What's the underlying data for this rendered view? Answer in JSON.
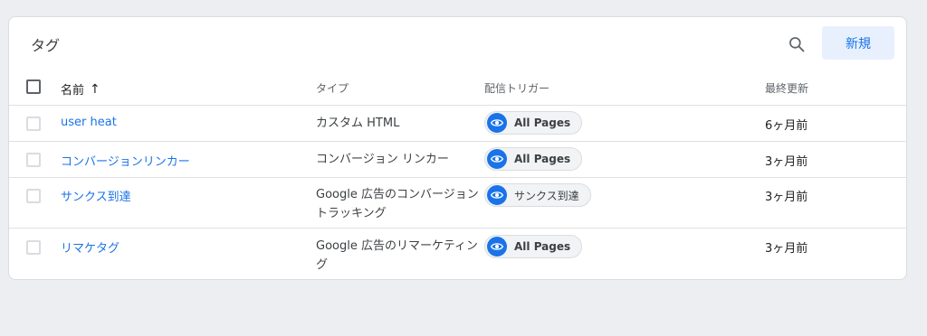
{
  "card": {
    "title": "タグ",
    "new_button": "新規",
    "search_icon": "search-icon"
  },
  "columns": {
    "name": "名前",
    "type": "タイプ",
    "trigger": "配信トリガー",
    "updated": "最終更新",
    "sort_arrow": "↑"
  },
  "colors": {
    "accent": "#1a73e8",
    "chip_bg": "#f1f3f4"
  },
  "rows": [
    {
      "name": "user heat",
      "type": "カスタム HTML",
      "trigger": "All Pages",
      "updated": "6ヶ月前"
    },
    {
      "name": "コンバージョンリンカー",
      "type": "コンバージョン リンカー",
      "trigger": "All Pages",
      "updated": "3ヶ月前"
    },
    {
      "name": "サンクス到達",
      "type": "Google 広告のコンバージョン トラッキング",
      "trigger": "サンクス到達",
      "updated": "3ヶ月前"
    },
    {
      "name": "リマケタグ",
      "type": "Google 広告のリマーケティング",
      "trigger": "All Pages",
      "updated": "3ヶ月前"
    }
  ]
}
